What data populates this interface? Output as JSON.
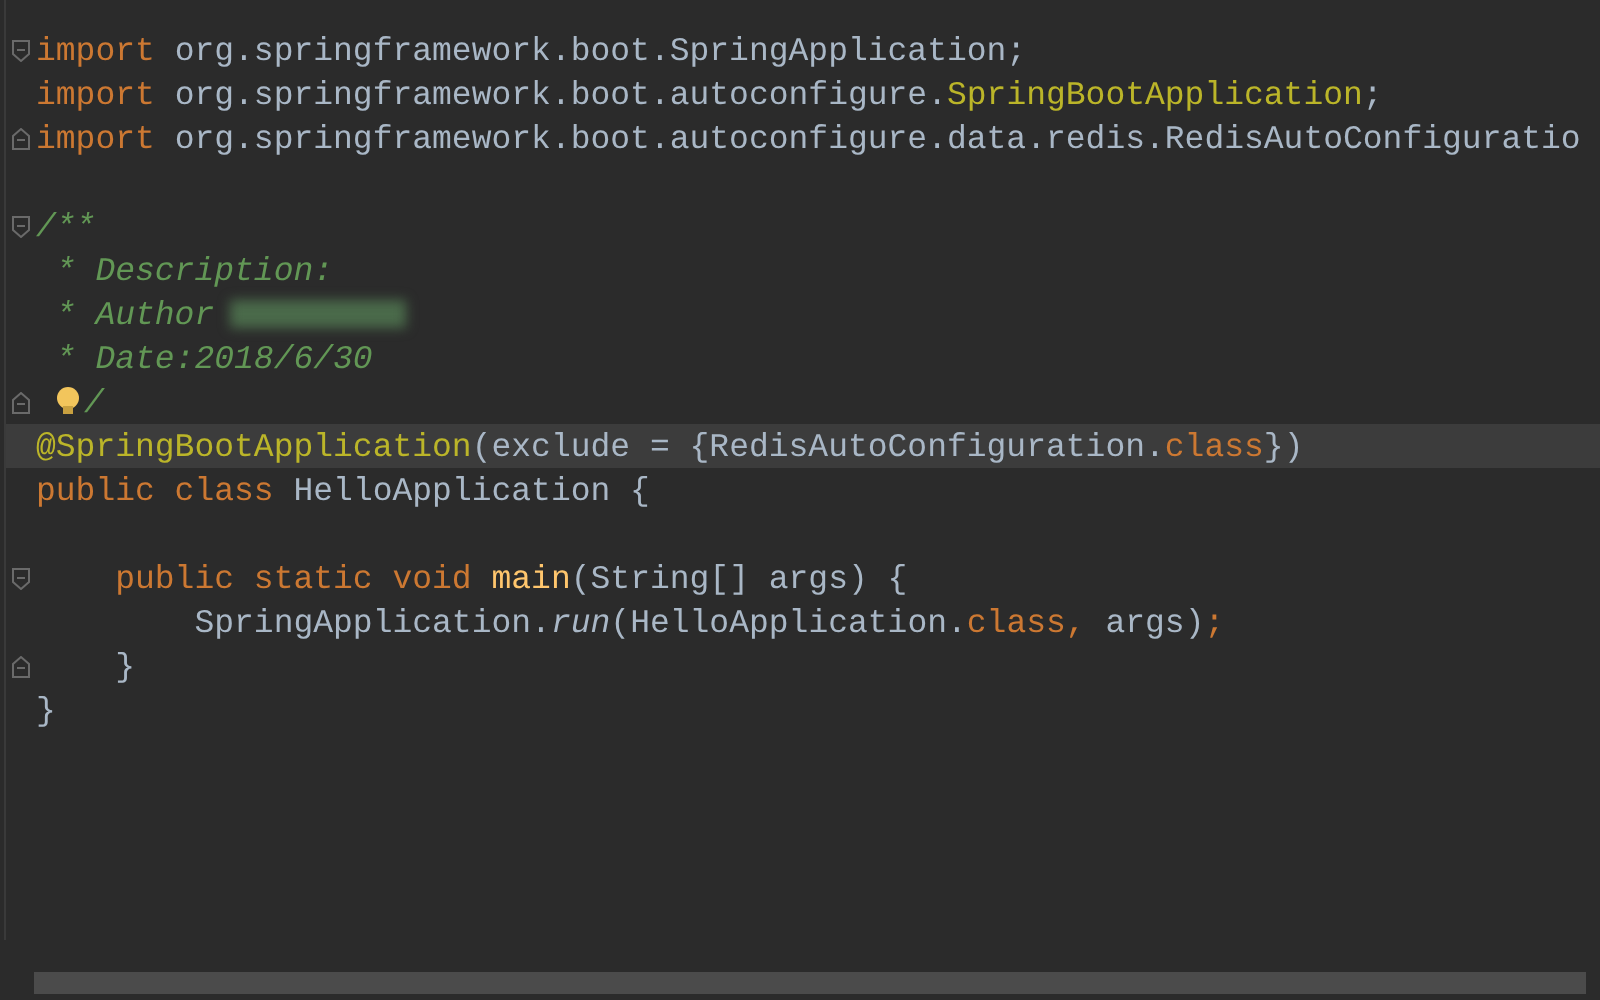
{
  "editor": {
    "lines": [
      {
        "fold_start": true,
        "fold_end": false,
        "current": false,
        "bulb": false,
        "redacted": false,
        "tokens": [
          {
            "kind": "keyword",
            "text": "import "
          },
          {
            "kind": "plain",
            "text": "org.springframework.boot.SpringApplication;"
          }
        ]
      },
      {
        "fold_start": false,
        "fold_end": false,
        "current": false,
        "bulb": false,
        "redacted": false,
        "tokens": [
          {
            "kind": "keyword",
            "text": "import "
          },
          {
            "kind": "plain",
            "text": "org.springframework.boot.autoconfigure."
          },
          {
            "kind": "annotation",
            "text": "SpringBootApplication"
          },
          {
            "kind": "plain",
            "text": ";"
          }
        ]
      },
      {
        "fold_start": false,
        "fold_end": true,
        "current": false,
        "bulb": false,
        "redacted": false,
        "tokens": [
          {
            "kind": "keyword",
            "text": "import "
          },
          {
            "kind": "plain",
            "text": "org.springframework.boot.autoconfigure.data.redis.RedisAutoConfiguratio"
          }
        ]
      },
      {
        "fold_start": false,
        "fold_end": false,
        "current": false,
        "bulb": false,
        "redacted": false
      },
      {
        "fold_start": true,
        "fold_end": false,
        "current": false,
        "bulb": false,
        "redacted": false,
        "tokens": [
          {
            "kind": "comment",
            "text": "/**"
          }
        ]
      },
      {
        "fold_start": false,
        "fold_end": false,
        "current": false,
        "bulb": false,
        "redacted": false,
        "tokens": [
          {
            "kind": "comment",
            "text": " * Description:"
          }
        ]
      },
      {
        "fold_start": false,
        "fold_end": false,
        "current": false,
        "bulb": false,
        "redacted": true,
        "tokens": [
          {
            "kind": "comment",
            "text": " * Author"
          }
        ]
      },
      {
        "fold_start": false,
        "fold_end": false,
        "current": false,
        "bulb": false,
        "redacted": false,
        "tokens": [
          {
            "kind": "comment",
            "text": " * Date:2018/6/30"
          }
        ]
      },
      {
        "fold_start": false,
        "fold_end": true,
        "current": false,
        "bulb": true,
        "redacted": false,
        "tokens": [
          {
            "kind": "comment",
            "text": "/"
          }
        ]
      },
      {
        "fold_start": false,
        "fold_end": false,
        "current": true,
        "bulb": false,
        "redacted": false,
        "tokens": [
          {
            "kind": "annotation",
            "text": "@SpringBootApplication"
          },
          {
            "kind": "plain",
            "text": "(exclude = {RedisAutoConfiguration."
          },
          {
            "kind": "keyword",
            "text": "class"
          },
          {
            "kind": "plain",
            "text": "})"
          }
        ]
      },
      {
        "fold_start": false,
        "fold_end": false,
        "current": false,
        "bulb": false,
        "redacted": false,
        "tokens": [
          {
            "kind": "keyword",
            "text": "public class "
          },
          {
            "kind": "plain",
            "text": "HelloApplication {"
          }
        ]
      },
      {
        "fold_start": false,
        "fold_end": false,
        "current": false,
        "bulb": false,
        "redacted": false
      },
      {
        "fold_start": true,
        "fold_end": false,
        "current": false,
        "bulb": false,
        "redacted": false,
        "tokens": [
          {
            "kind": "keyword",
            "text": "    public static void "
          },
          {
            "kind": "method",
            "text": "main"
          },
          {
            "kind": "plain",
            "text": "(String[] args) {"
          }
        ]
      },
      {
        "fold_start": false,
        "fold_end": false,
        "current": false,
        "bulb": false,
        "redacted": false,
        "tokens": [
          {
            "kind": "plain",
            "text": "        SpringApplication."
          },
          {
            "kind": "call",
            "text": "run"
          },
          {
            "kind": "plain",
            "text": "(HelloApplication."
          },
          {
            "kind": "keyword",
            "text": "class, "
          },
          {
            "kind": "plain",
            "text": "args)"
          },
          {
            "kind": "keyword",
            "text": ";"
          }
        ]
      },
      {
        "fold_start": false,
        "fold_end": true,
        "current": false,
        "bulb": false,
        "redacted": false,
        "tokens": [
          {
            "kind": "plain",
            "text": "    }"
          }
        ]
      },
      {
        "fold_start": false,
        "fold_end": false,
        "current": false,
        "bulb": false,
        "redacted": false,
        "tokens": [
          {
            "kind": "plain",
            "text": "}"
          }
        ]
      }
    ]
  }
}
